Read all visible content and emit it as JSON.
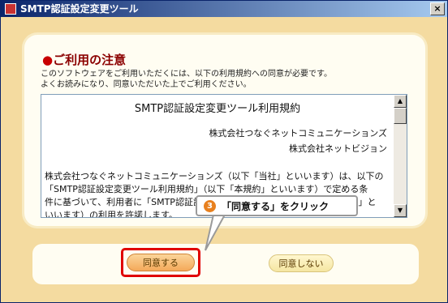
{
  "window": {
    "title": "SMTP認証設定変更ツール",
    "close_label": "×"
  },
  "notice": {
    "heading_bullet": "●",
    "heading": "ご利用の注意",
    "lines": [
      "このソフトウェアをご利用いただくには、以下の利用規約への同意が必要です。",
      "よくお読みになり、同意いただいた上でご利用ください。"
    ]
  },
  "agreement": {
    "title": "SMTP認証設定変更ツール利用規約",
    "companies": [
      "株式会社つなぐネットコミュニケーションズ",
      "株式会社ネットビジョン"
    ],
    "body_lines": [
      "株式会社つなぐネットコミュニケーションズ（以下「当社」といいます）は、以下の",
      "「SMTP認証設定変更ツール利用規約」（以下「本規約」といいます）で定める条",
      "件に基づいて、利用者に「SMTP認証設定変更ツール」（以下「本ソフトウェア」と",
      "いいます）の利用を許諾します。"
    ]
  },
  "scrollbar": {
    "up_arrow": "▲",
    "down_arrow": "▼"
  },
  "buttons": {
    "agree": "同意する",
    "disagree": "同意しない"
  },
  "callout": {
    "step": "3",
    "text": "「同意する」をクリック"
  }
}
